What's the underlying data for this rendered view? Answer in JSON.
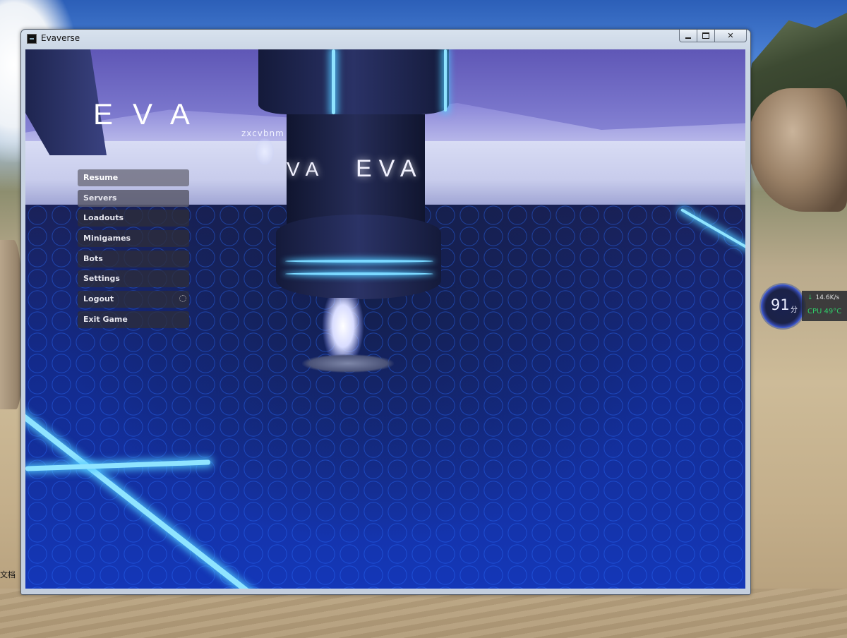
{
  "window": {
    "title": "Evaverse",
    "controls": {
      "close": "✕"
    }
  },
  "game": {
    "logo": "EVA",
    "tower_text_left": "VA",
    "tower_text_right": "EVA",
    "player_name": "zxcvbnm"
  },
  "menu": {
    "items": [
      {
        "label": "Resume"
      },
      {
        "label": "Servers"
      },
      {
        "label": "Loadouts"
      },
      {
        "label": "Minigames"
      },
      {
        "label": "Bots"
      },
      {
        "label": "Settings"
      },
      {
        "label": "Logout"
      },
      {
        "label": "Exit Game"
      }
    ]
  },
  "monitor": {
    "score": "91",
    "score_unit": "分",
    "net_speed": "14.6K/s",
    "cpu": "CPU 49°C"
  },
  "desktop": {
    "side_label": "文档"
  },
  "colors": {
    "neon": "#8fe4ff",
    "floor": "#1437b8",
    "menu_bg": "#2d2d3a",
    "cpu_green": "#2fd06a"
  }
}
